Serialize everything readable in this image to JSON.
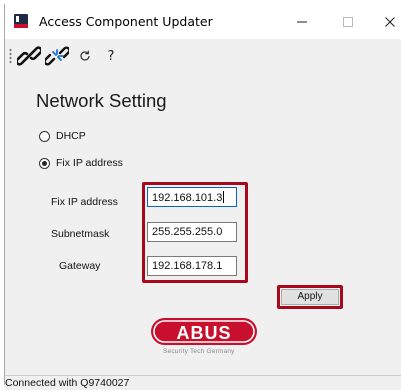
{
  "window": {
    "title": "Access Component Updater",
    "controls": {
      "minimize": "—",
      "maximize": "☐",
      "close": "✕"
    }
  },
  "toolbar": {
    "buttons": [
      {
        "name": "connect",
        "icon": "link-icon"
      },
      {
        "name": "disconnect",
        "icon": "broken-link-icon"
      },
      {
        "name": "refresh",
        "icon": "refresh-icon"
      },
      {
        "name": "help",
        "label": "?"
      }
    ]
  },
  "main": {
    "heading": "Network Setting",
    "mode": {
      "options": [
        {
          "label": "DHCP",
          "selected": false
        },
        {
          "label": "Fix IP address",
          "selected": true
        }
      ]
    },
    "fields": {
      "ip": {
        "label": "Fix IP address",
        "value": "192.168.101.3"
      },
      "subnet": {
        "label": "Subnetmask",
        "value": "255.255.255.0"
      },
      "gateway": {
        "label": "Gateway",
        "value": "192.168.178.1"
      }
    },
    "apply_label": "Apply"
  },
  "logo": {
    "brand": "ABUS",
    "tagline": "Security Tech Germany"
  },
  "status": {
    "text": "Connected with Q9740027"
  },
  "colors": {
    "highlight_red": "#a8091a",
    "focus_blue": "#0a64c8",
    "window_bg": "#f0f0f0"
  }
}
